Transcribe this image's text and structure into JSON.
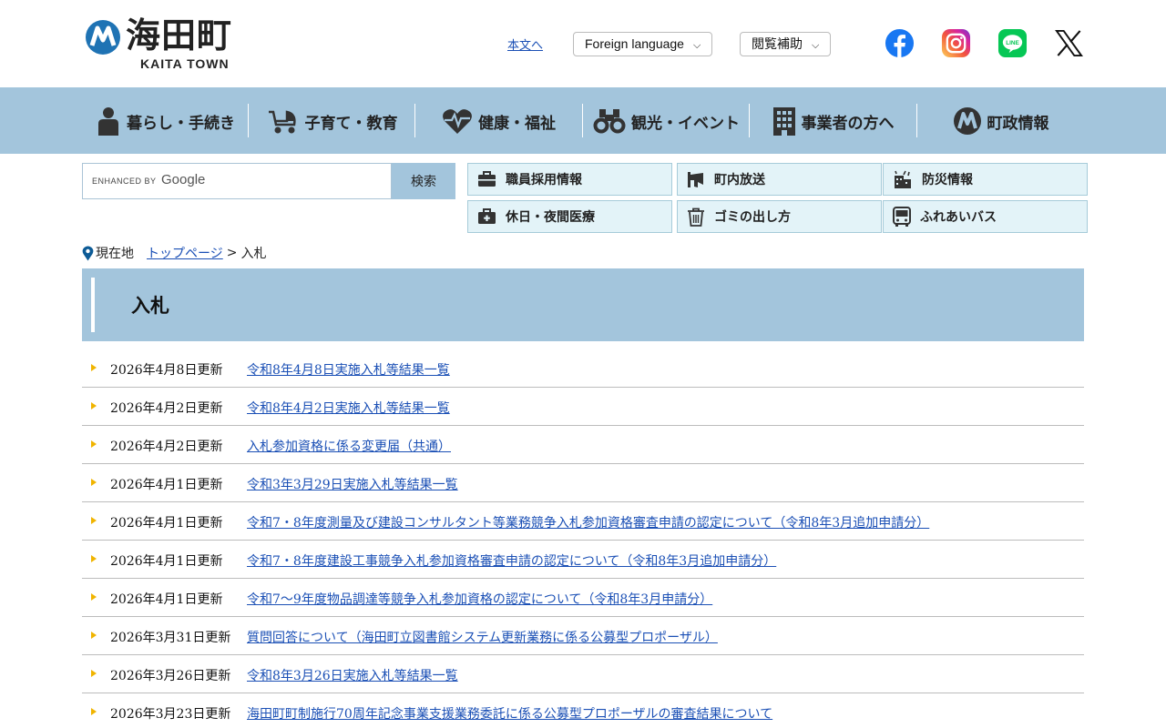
{
  "header": {
    "logo_ja": "海田町",
    "logo_en": "KAITA TOWN",
    "skip_link": "本文へ",
    "foreign_language": "Foreign language",
    "reading_aid": "閲覧補助"
  },
  "sns": [
    "facebook-icon",
    "instagram-icon",
    "line-icon",
    "x-icon"
  ],
  "colors": {
    "nav_bg": "#a3c5dc",
    "quick_bg": "#e3f3f8",
    "link": "#1a4fb5",
    "bullet": "#f0b400"
  },
  "gnav": [
    {
      "label": "暮らし・手続き",
      "icon": "person-icon"
    },
    {
      "label": "子育て・教育",
      "icon": "stroller-icon"
    },
    {
      "label": "健康・福祉",
      "icon": "heartbeat-icon"
    },
    {
      "label": "観光・イベント",
      "icon": "binoculars-icon"
    },
    {
      "label": "事業者の方へ",
      "icon": "building-icon"
    },
    {
      "label": "町政情報",
      "icon": "town-emblem-icon"
    }
  ],
  "search": {
    "enhanced_by": "ENHANCED BY",
    "google": "Google",
    "button": "検索"
  },
  "quick_links": [
    {
      "label": "職員採用情報",
      "icon": "briefcase-icon"
    },
    {
      "label": "町内放送",
      "icon": "megaphone-icon"
    },
    {
      "label": "防災情報",
      "icon": "disaster-icon"
    },
    {
      "label": "休日・夜間医療",
      "icon": "first-aid-icon"
    },
    {
      "label": "ゴミの出し方",
      "icon": "trash-icon"
    },
    {
      "label": "ふれあいバス",
      "icon": "bus-icon"
    }
  ],
  "breadcrumb": {
    "label": "現在地",
    "home": "トップページ",
    "separator": ">",
    "current": "入札"
  },
  "page_title": "入札",
  "items": [
    {
      "date": "2026年4月8日更新",
      "title": "令和8年4月8日実施入札等結果一覧"
    },
    {
      "date": "2026年4月2日更新",
      "title": "令和8年4月2日実施入札等結果一覧"
    },
    {
      "date": "2026年4月2日更新",
      "title": "入札参加資格に係る変更届（共通）"
    },
    {
      "date": "2026年4月1日更新",
      "title": "令和3年3月29日実施入札等結果一覧"
    },
    {
      "date": "2026年4月1日更新",
      "title": "令和7・8年度測量及び建設コンサルタント等業務競争入札参加資格審査申請の認定について（令和8年3月追加申請分）"
    },
    {
      "date": "2026年4月1日更新",
      "title": "令和7・8年度建設工事競争入札参加資格審査申請の認定について（令和8年3月追加申請分）"
    },
    {
      "date": "2026年4月1日更新",
      "title": "令和7～9年度物品調達等競争入札参加資格の認定について（令和8年3月申請分）"
    },
    {
      "date": "2026年3月31日更新",
      "title": "質問回答について（海田町立図書館システム更新業務に係る公募型プロポーザル）"
    },
    {
      "date": "2026年3月26日更新",
      "title": "令和8年3月26日実施入札等結果一覧"
    },
    {
      "date": "2026年3月23日更新",
      "title": "海田町町制施行70周年記念事業支援業務委託に係る公募型プロポーザルの審査結果について"
    }
  ]
}
